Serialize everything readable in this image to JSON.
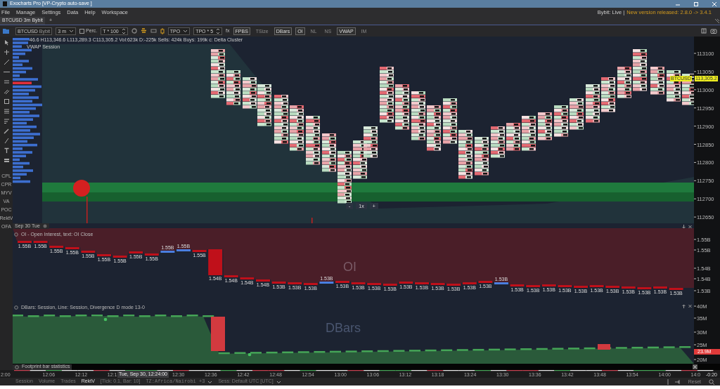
{
  "window": {
    "title": "Exocharts  Pro  [VP-Crypto  auto-save ]"
  },
  "menu": [
    "File",
    "Manage",
    "Settings",
    "Data",
    "Help",
    "Workspace"
  ],
  "connection": "Bybit: Live |",
  "update_notice": "New version released: 2.8.0 -> 3.4.1",
  "tabs": [
    {
      "label": "BTCUSD 3m Bybit",
      "selected": true
    }
  ],
  "add_tab": "+",
  "toolbar": {
    "symbol": "BTCUSD",
    "exchange": "Bybit",
    "timeframe": "3 m",
    "percent": {
      "label": "Perc.",
      "checked": false
    },
    "tick_multiplier": "T * 100",
    "mode": "TPO",
    "tpo_multiplier": "TPO * 5",
    "formula": "fx",
    "toggles": [
      {
        "label": "FPBS",
        "selected": true
      },
      {
        "label": "TSize",
        "selected": false
      },
      {
        "label": "DBars",
        "selected": true
      },
      {
        "label": "OI",
        "selected": true
      },
      {
        "label": "NL",
        "selected": false
      },
      {
        "label": "NS",
        "selected": false
      },
      {
        "label": "VWAP",
        "selected": true
      },
      {
        "label": "IM",
        "selected": false
      }
    ]
  },
  "left_labels": [
    "CPL",
    "CPR",
    "MYV",
    "VA",
    "POC",
    "RektV",
    "OFA"
  ],
  "price_pane": {
    "ohlc": "46.6 H113,346.6 L113,289.3 C113,305.2 Vol:623k D:-225k Sells: 424k Buys: 199k c: Delta Cluster",
    "overlay": "VWAP Session",
    "axis": [
      "113100",
      "113050",
      "113000",
      "112950",
      "112900",
      "112850",
      "112800",
      "112750",
      "112700",
      "112650"
    ],
    "symbol_tag": "BTCUSD",
    "last_price": "113,305.2",
    "zoom": {
      "minus": "-",
      "level": "1x",
      "plus": "+"
    }
  },
  "date_label": "Sep 30 Tue",
  "oi_pane": {
    "title": "OI - Open Interest, text: OI Close",
    "watermark": "OI",
    "axis": [
      "1.55B",
      "1.55B",
      "1.54B",
      "1.54B",
      "1.53B"
    ],
    "bars": [
      {
        "label": "1.55B",
        "kind": "down"
      },
      {
        "label": "1.55B",
        "kind": "down"
      },
      {
        "label": "1.55B",
        "kind": "down"
      },
      {
        "label": "1.55B",
        "kind": "down"
      },
      {
        "label": "1.55B",
        "kind": "down"
      },
      {
        "label": "1.55B",
        "kind": "down"
      },
      {
        "label": "1.55B",
        "kind": "down"
      },
      {
        "label": "1.55B",
        "kind": "down"
      },
      {
        "label": "1.55B",
        "kind": "down"
      },
      {
        "label": "1.55B",
        "kind": "up"
      },
      {
        "label": "1.55B",
        "kind": "up"
      },
      {
        "label": "1.55B",
        "kind": "down"
      },
      {
        "label": "1.54B",
        "kind": "down"
      },
      {
        "label": "1.54B",
        "kind": "down"
      },
      {
        "label": "1.54B",
        "kind": "down"
      },
      {
        "label": "1.54B",
        "kind": "down"
      },
      {
        "label": "1.53B",
        "kind": "down"
      },
      {
        "label": "1.53B",
        "kind": "down"
      },
      {
        "label": "1.53B",
        "kind": "down"
      },
      {
        "label": "1.53B",
        "kind": "up"
      },
      {
        "label": "1.53B",
        "kind": "down"
      },
      {
        "label": "1.53B",
        "kind": "down"
      },
      {
        "label": "1.53B",
        "kind": "down"
      },
      {
        "label": "1.53B",
        "kind": "down"
      },
      {
        "label": "1.53B",
        "kind": "down"
      },
      {
        "label": "1.53B",
        "kind": "down"
      },
      {
        "label": "1.53B",
        "kind": "down"
      },
      {
        "label": "1.53B",
        "kind": "down"
      },
      {
        "label": "1.53B",
        "kind": "down"
      },
      {
        "label": "1.53B",
        "kind": "down"
      },
      {
        "label": "1.53B",
        "kind": "up"
      },
      {
        "label": "1.53B",
        "kind": "down"
      },
      {
        "label": "1.53B",
        "kind": "down"
      },
      {
        "label": "1.53B",
        "kind": "down"
      },
      {
        "label": "1.53B",
        "kind": "down"
      },
      {
        "label": "1.53B",
        "kind": "down"
      },
      {
        "label": "1.53B",
        "kind": "down"
      },
      {
        "label": "1.53B",
        "kind": "down"
      },
      {
        "label": "1.53B",
        "kind": "down"
      },
      {
        "label": "1.53B",
        "kind": "down"
      },
      {
        "label": "1.53B",
        "kind": "down"
      },
      {
        "label": "1.53B",
        "kind": "down"
      }
    ]
  },
  "dbars_pane": {
    "title": "DBars: Session, Line: Session, Divergence D mode 13-0",
    "watermark": "DBars",
    "axis": [
      "40M",
      "35M",
      "30M",
      "25M",
      "20M"
    ],
    "last_value": "23.9M"
  },
  "stats_strip": {
    "title": "Footprint bar statistics"
  },
  "time_axis": {
    "ticks_before": [
      "2:00",
      "12:06",
      "12:12",
      "12:1"
    ],
    "cursor_label": "Tue, Sep 30, 12:24:00",
    "ticks_after": [
      "12:30",
      "12:36",
      "12:42",
      "12:48",
      "12:54",
      "13:00",
      "13:06",
      "13:12",
      "13:18",
      "13:24",
      "13:30",
      "13:36",
      "13:42",
      "13:48",
      "13:54",
      "14:00",
      "14:0"
    ],
    "offset": "-0:20"
  },
  "status_bar": {
    "items": [
      {
        "label": "Session",
        "selected": false
      },
      {
        "label": "Volume",
        "selected": false
      },
      {
        "label": "Trades",
        "selected": false
      },
      {
        "label": "RektV",
        "selected": true
      }
    ],
    "tick_info": "[Tick: 0.1, Bar: 10]",
    "timezone": "TZ:Africa/Nairobi +3",
    "session": "Sess: Default UTC [UTC]",
    "reset": "Reset"
  }
}
